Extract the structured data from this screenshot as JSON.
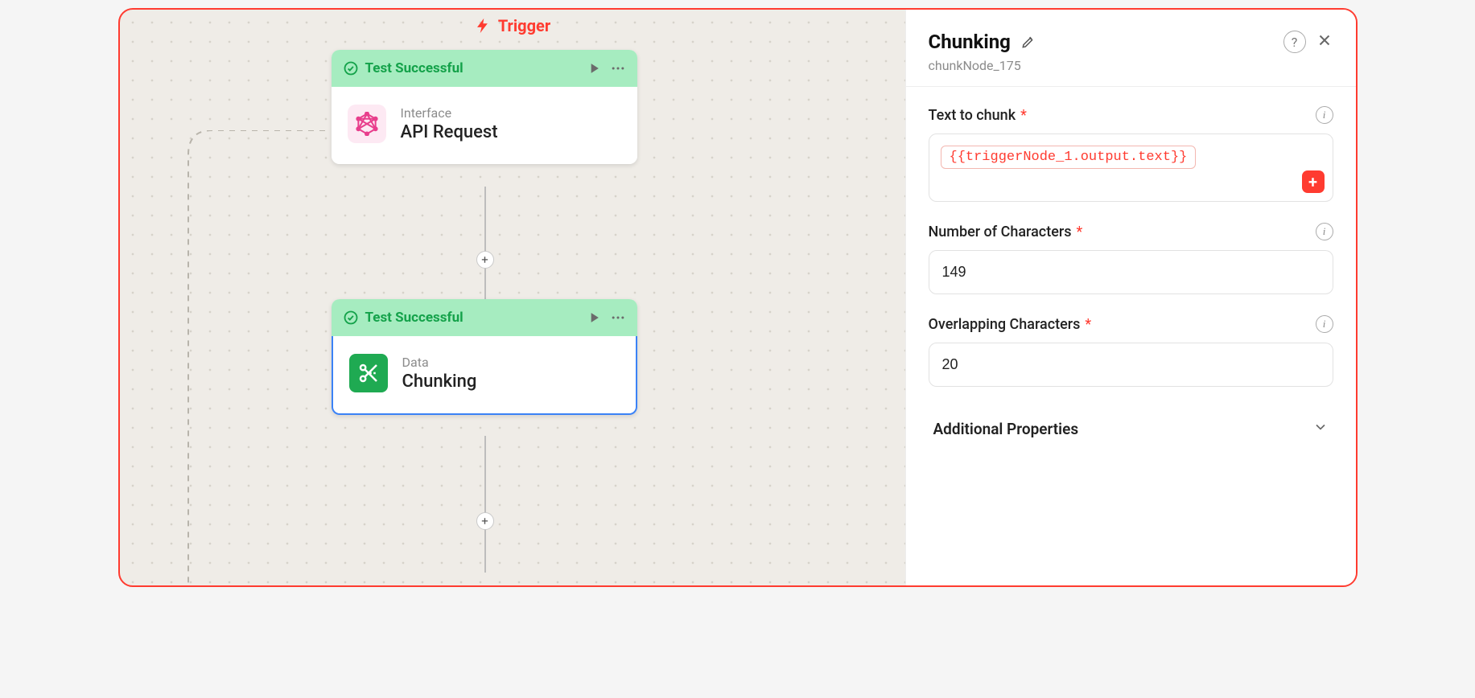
{
  "trigger_label": "Trigger",
  "nodes": {
    "n1": {
      "status": "Test Successful",
      "category": "Interface",
      "title": "API Request"
    },
    "n2": {
      "status": "Test Successful",
      "category": "Data",
      "title": "Chunking"
    }
  },
  "panel": {
    "title": "Chunking",
    "id": "chunkNode_175",
    "fields": {
      "text_to_chunk": {
        "label": "Text to chunk",
        "token": "{{triggerNode_1.output.text}}"
      },
      "num_chars": {
        "label": "Number of Characters",
        "value": "149"
      },
      "overlap": {
        "label": "Overlapping Characters",
        "value": "20"
      }
    },
    "accordion": "Additional Properties"
  }
}
